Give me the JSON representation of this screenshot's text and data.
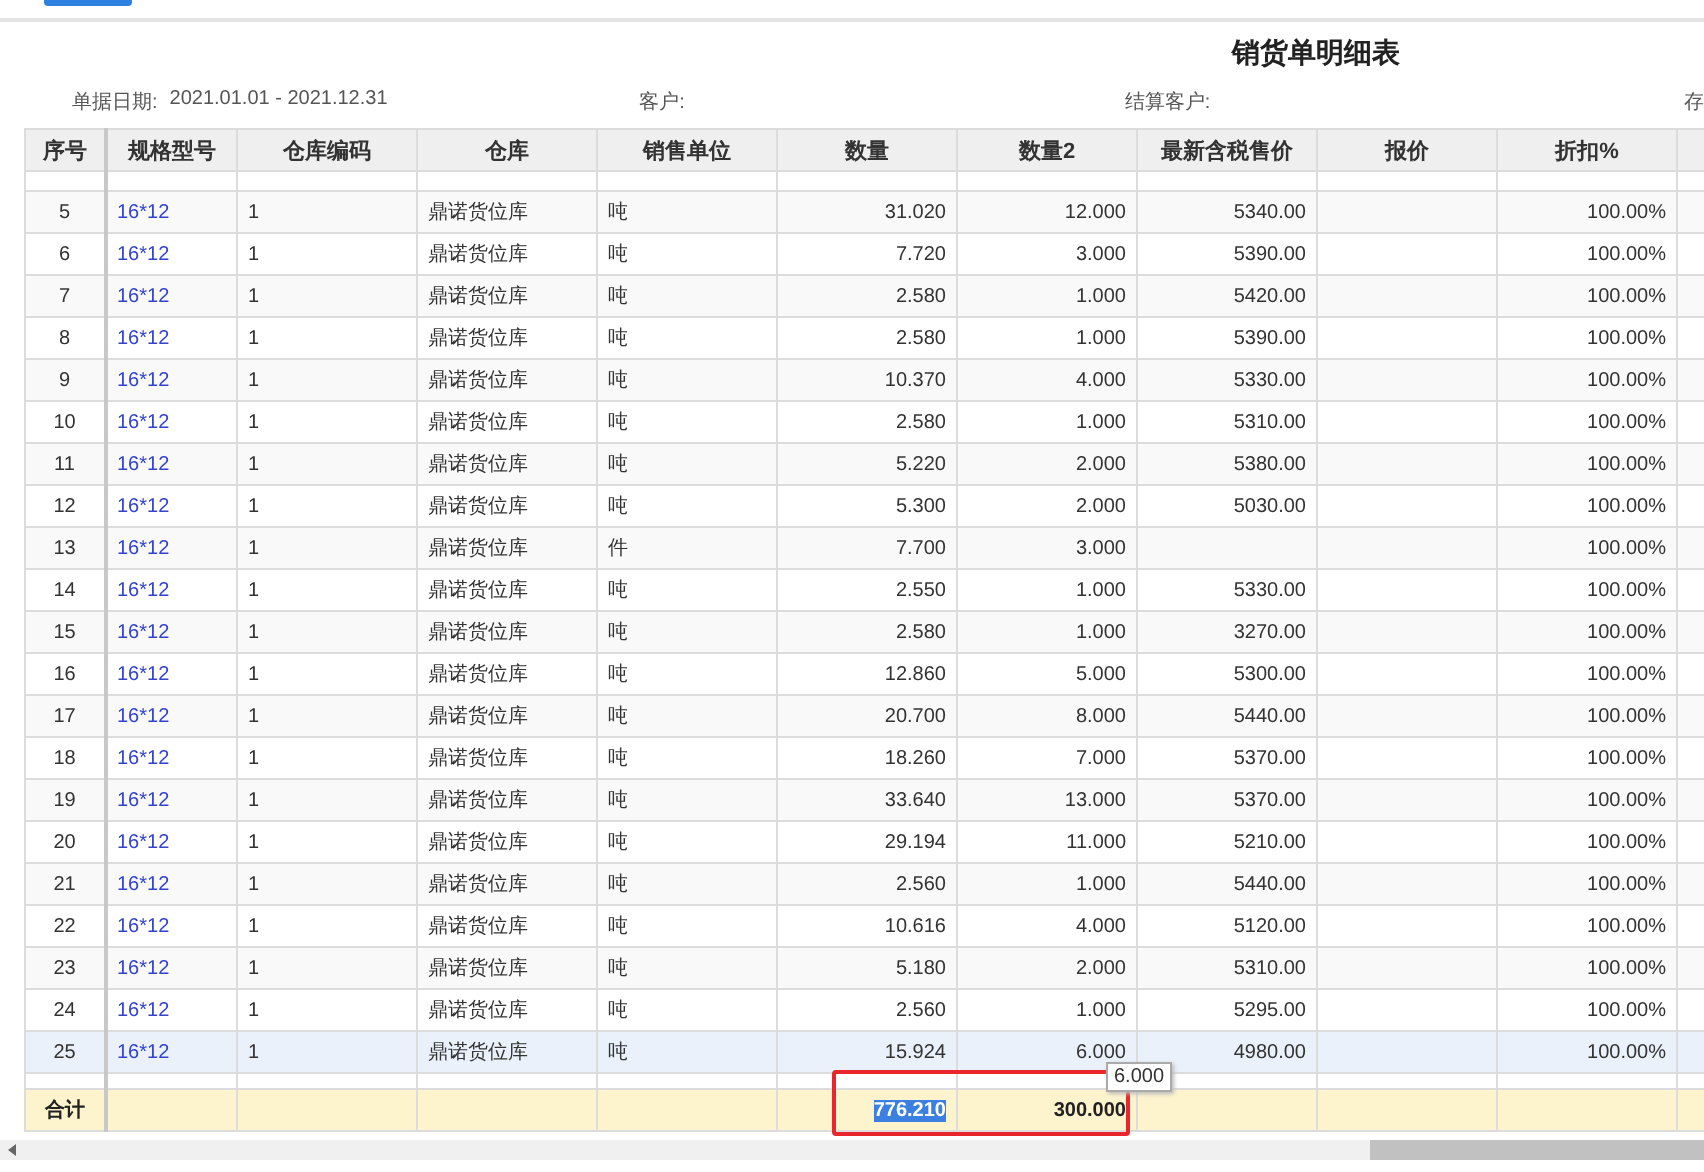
{
  "toolbar": {
    "button_visible": true
  },
  "report": {
    "title": "销货单明细表",
    "filters": [
      {
        "label": "单据日期:",
        "value": "2021.01.01 - 2021.12.31"
      },
      {
        "label": "客户:"
      },
      {
        "label": "结算客户:"
      },
      {
        "label": "存"
      }
    ]
  },
  "table": {
    "columns": [
      "序号",
      "规格型号",
      "仓库编码",
      "仓库",
      "销售单位",
      "数量",
      "数量2",
      "最新含税售价",
      "报价",
      "折扣%"
    ],
    "rows": [
      {
        "no": "5",
        "spec": "16*12",
        "code": "1",
        "warehouse": "鼎诺货位库",
        "unit": "吨",
        "qty": "31.020",
        "qty2": "12.000",
        "price": "5340.00",
        "discount": "100.00%",
        "selected": false
      },
      {
        "no": "6",
        "spec": "16*12",
        "code": "1",
        "warehouse": "鼎诺货位库",
        "unit": "吨",
        "qty": "7.720",
        "qty2": "3.000",
        "price": "5390.00",
        "discount": "100.00%",
        "selected": false
      },
      {
        "no": "7",
        "spec": "16*12",
        "code": "1",
        "warehouse": "鼎诺货位库",
        "unit": "吨",
        "qty": "2.580",
        "qty2": "1.000",
        "price": "5420.00",
        "discount": "100.00%",
        "selected": false
      },
      {
        "no": "8",
        "spec": "16*12",
        "code": "1",
        "warehouse": "鼎诺货位库",
        "unit": "吨",
        "qty": "2.580",
        "qty2": "1.000",
        "price": "5390.00",
        "discount": "100.00%",
        "selected": false
      },
      {
        "no": "9",
        "spec": "16*12",
        "code": "1",
        "warehouse": "鼎诺货位库",
        "unit": "吨",
        "qty": "10.370",
        "qty2": "4.000",
        "price": "5330.00",
        "discount": "100.00%",
        "selected": false
      },
      {
        "no": "10",
        "spec": "16*12",
        "code": "1",
        "warehouse": "鼎诺货位库",
        "unit": "吨",
        "qty": "2.580",
        "qty2": "1.000",
        "price": "5310.00",
        "discount": "100.00%",
        "selected": false
      },
      {
        "no": "11",
        "spec": "16*12",
        "code": "1",
        "warehouse": "鼎诺货位库",
        "unit": "吨",
        "qty": "5.220",
        "qty2": "2.000",
        "price": "5380.00",
        "discount": "100.00%",
        "selected": false
      },
      {
        "no": "12",
        "spec": "16*12",
        "code": "1",
        "warehouse": "鼎诺货位库",
        "unit": "吨",
        "qty": "5.300",
        "qty2": "2.000",
        "price": "5030.00",
        "discount": "100.00%",
        "selected": false
      },
      {
        "no": "13",
        "spec": "16*12",
        "code": "1",
        "warehouse": "鼎诺货位库",
        "unit": "件",
        "qty": "7.700",
        "qty2": "3.000",
        "discount": "100.00%",
        "selected": false
      },
      {
        "no": "14",
        "spec": "16*12",
        "code": "1",
        "warehouse": "鼎诺货位库",
        "unit": "吨",
        "qty": "2.550",
        "qty2": "1.000",
        "price": "5330.00",
        "discount": "100.00%",
        "selected": false
      },
      {
        "no": "15",
        "spec": "16*12",
        "code": "1",
        "warehouse": "鼎诺货位库",
        "unit": "吨",
        "qty": "2.580",
        "qty2": "1.000",
        "price": "3270.00",
        "discount": "100.00%",
        "selected": false
      },
      {
        "no": "16",
        "spec": "16*12",
        "code": "1",
        "warehouse": "鼎诺货位库",
        "unit": "吨",
        "qty": "12.860",
        "qty2": "5.000",
        "price": "5300.00",
        "discount": "100.00%",
        "selected": false
      },
      {
        "no": "17",
        "spec": "16*12",
        "code": "1",
        "warehouse": "鼎诺货位库",
        "unit": "吨",
        "qty": "20.700",
        "qty2": "8.000",
        "price": "5440.00",
        "discount": "100.00%",
        "selected": false
      },
      {
        "no": "18",
        "spec": "16*12",
        "code": "1",
        "warehouse": "鼎诺货位库",
        "unit": "吨",
        "qty": "18.260",
        "qty2": "7.000",
        "price": "5370.00",
        "discount": "100.00%",
        "selected": false
      },
      {
        "no": "19",
        "spec": "16*12",
        "code": "1",
        "warehouse": "鼎诺货位库",
        "unit": "吨",
        "qty": "33.640",
        "qty2": "13.000",
        "price": "5370.00",
        "discount": "100.00%",
        "selected": false
      },
      {
        "no": "20",
        "spec": "16*12",
        "code": "1",
        "warehouse": "鼎诺货位库",
        "unit": "吨",
        "qty": "29.194",
        "qty2": "11.000",
        "price": "5210.00",
        "discount": "100.00%",
        "selected": false
      },
      {
        "no": "21",
        "spec": "16*12",
        "code": "1",
        "warehouse": "鼎诺货位库",
        "unit": "吨",
        "qty": "2.560",
        "qty2": "1.000",
        "price": "5440.00",
        "discount": "100.00%",
        "selected": false
      },
      {
        "no": "22",
        "spec": "16*12",
        "code": "1",
        "warehouse": "鼎诺货位库",
        "unit": "吨",
        "qty": "10.616",
        "qty2": "4.000",
        "price": "5120.00",
        "discount": "100.00%",
        "selected": false
      },
      {
        "no": "23",
        "spec": "16*12",
        "code": "1",
        "warehouse": "鼎诺货位库",
        "unit": "吨",
        "qty": "5.180",
        "qty2": "2.000",
        "price": "5310.00",
        "discount": "100.00%",
        "selected": false
      },
      {
        "no": "24",
        "spec": "16*12",
        "code": "1",
        "warehouse": "鼎诺货位库",
        "unit": "吨",
        "qty": "2.560",
        "qty2": "1.000",
        "price": "5295.00",
        "discount": "100.00%",
        "selected": false
      },
      {
        "no": "25",
        "spec": "16*12",
        "code": "1",
        "warehouse": "鼎诺货位库",
        "unit": "吨",
        "qty": "15.924",
        "qty2": "6.000",
        "price": "4980.00",
        "discount": "100.00%",
        "selected": true
      }
    ],
    "totals": {
      "label": "合计",
      "qty": {
        "text": "776.210",
        "selected": true
      },
      "qty2": {
        "text": "300.000",
        "selected": false
      }
    }
  },
  "tooltip": "6.000"
}
